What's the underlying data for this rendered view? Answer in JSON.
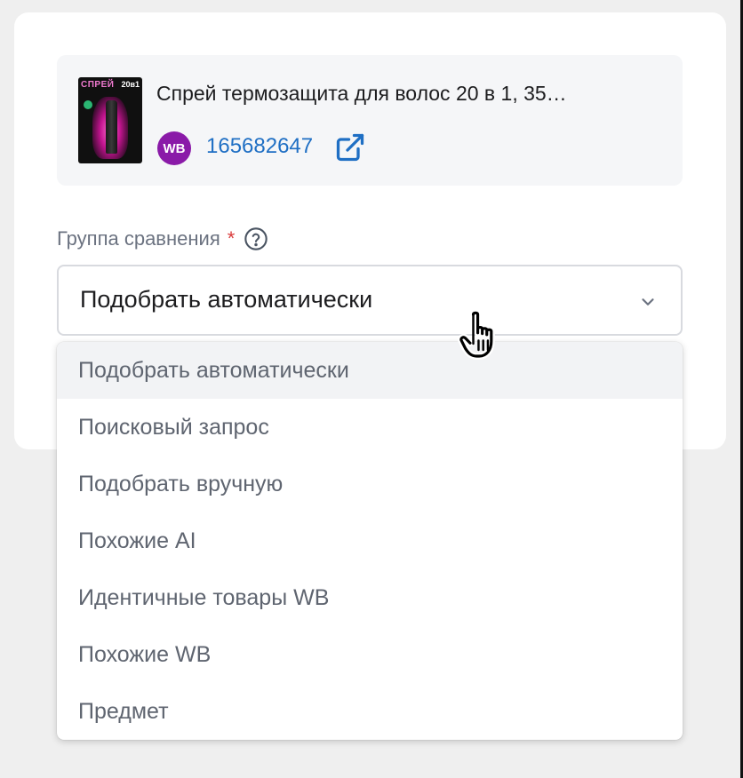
{
  "product": {
    "title": "Спрей термозащита для волос 20 в 1, 35…",
    "marketplace_badge": "WB",
    "sku": "165682647",
    "thumb_brand": "СПРЕЙ",
    "thumb_badge": "20в1"
  },
  "field": {
    "label": "Группа сравнения",
    "required_mark": "*",
    "selected_value": "Подобрать автоматически"
  },
  "dropdown": {
    "options": [
      "Подобрать автоматически",
      "Поисковый запрос",
      "Подобрать вручную",
      "Похожие AI",
      "Идентичные товары WB",
      "Похожие WB",
      "Предмет"
    ],
    "hovered_index": 0
  },
  "icons": {
    "external": "external-link-icon",
    "help": "help-circle-icon",
    "chevron": "chevron-down-icon",
    "cursor": "hand-pointer-cursor-icon"
  },
  "colors": {
    "link": "#1f6fc4",
    "wb_brand": "#8a1aa8",
    "required": "#d93a3a"
  }
}
